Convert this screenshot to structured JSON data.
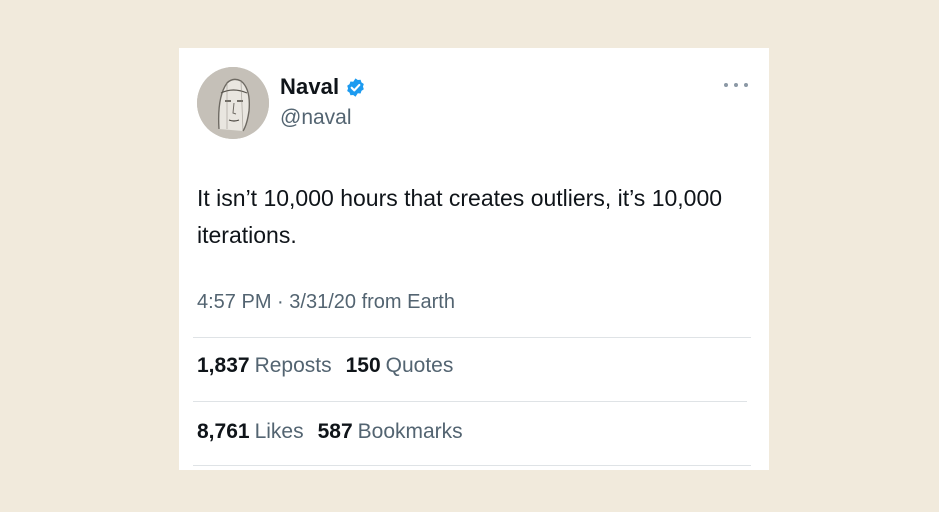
{
  "tweet": {
    "display_name": "Naval",
    "handle": "@naval",
    "verified": true,
    "verified_color": "#1d9bf0",
    "text": "It isn’t 10,000 hours that creates outliers, it’s 10,000 iterations.",
    "time": "4:57 PM",
    "separator": "·",
    "date": "3/31/20",
    "source": "from Earth",
    "more_icon": "more-dots-icon",
    "stats_row1": [
      {
        "count": "1,837",
        "label": "Reposts"
      },
      {
        "count": "150",
        "label": "Quotes"
      }
    ],
    "stats_row2": [
      {
        "count": "8,761",
        "label": "Likes"
      },
      {
        "count": "587",
        "label": "Bookmarks"
      }
    ]
  },
  "colors": {
    "background": "#f1eadc",
    "card": "#ffffff",
    "text_primary": "#0f1419",
    "text_secondary": "#536471"
  }
}
